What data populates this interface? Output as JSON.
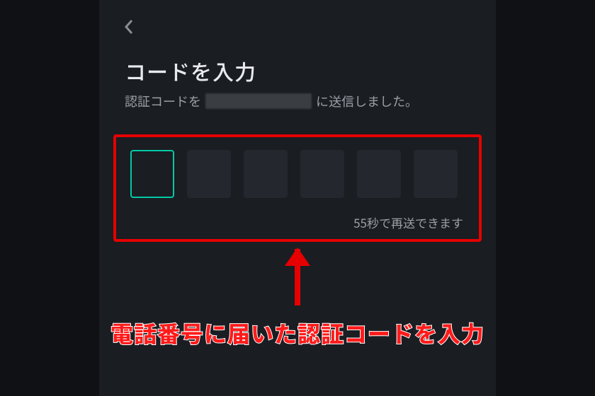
{
  "header": {
    "back_icon": "chevron-left"
  },
  "title": "コードを入力",
  "subtitle": {
    "prefix": "認証コードを",
    "suffix": "に送信しました。"
  },
  "code_input": {
    "length": 6,
    "active_index": 0
  },
  "resend": {
    "seconds": 55,
    "text": "55秒で再送できます"
  },
  "annotation": {
    "caption": "電話番号に届いた認証コードを入力",
    "highlight_color": "#e60000"
  }
}
